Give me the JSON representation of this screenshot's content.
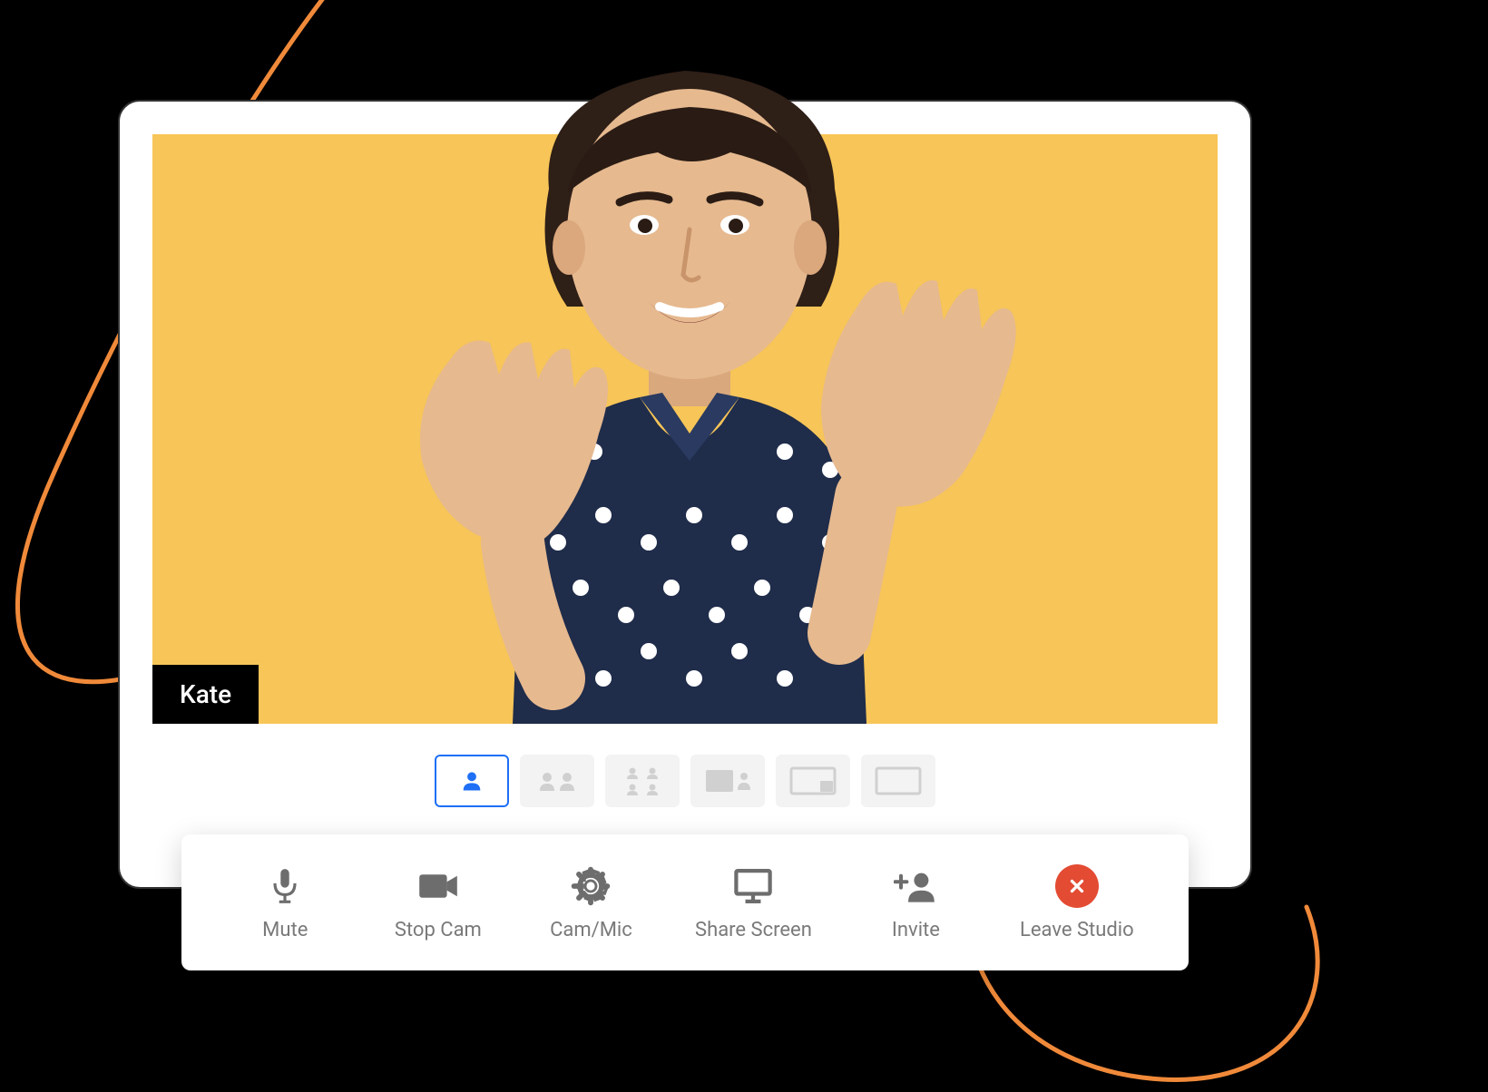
{
  "participant": {
    "name": "Kate"
  },
  "layouts": {
    "items": [
      {
        "id": "single",
        "active": true
      },
      {
        "id": "two-up",
        "active": false
      },
      {
        "id": "grid-2x2",
        "active": false
      },
      {
        "id": "presenter-side",
        "active": false
      },
      {
        "id": "presenter-overlay",
        "active": false
      },
      {
        "id": "fullscreen",
        "active": false
      }
    ]
  },
  "toolbar": {
    "mute": "Mute",
    "stopCam": "Stop Cam",
    "camMic": "Cam/Mic",
    "shareScreen": "Share Screen",
    "invite": "Invite",
    "leave": "Leave Studio"
  },
  "colors": {
    "accent": "#1e6ff5",
    "videoBg": "#f7c558",
    "danger": "#e34b33",
    "swirl": "#f08a3a"
  }
}
